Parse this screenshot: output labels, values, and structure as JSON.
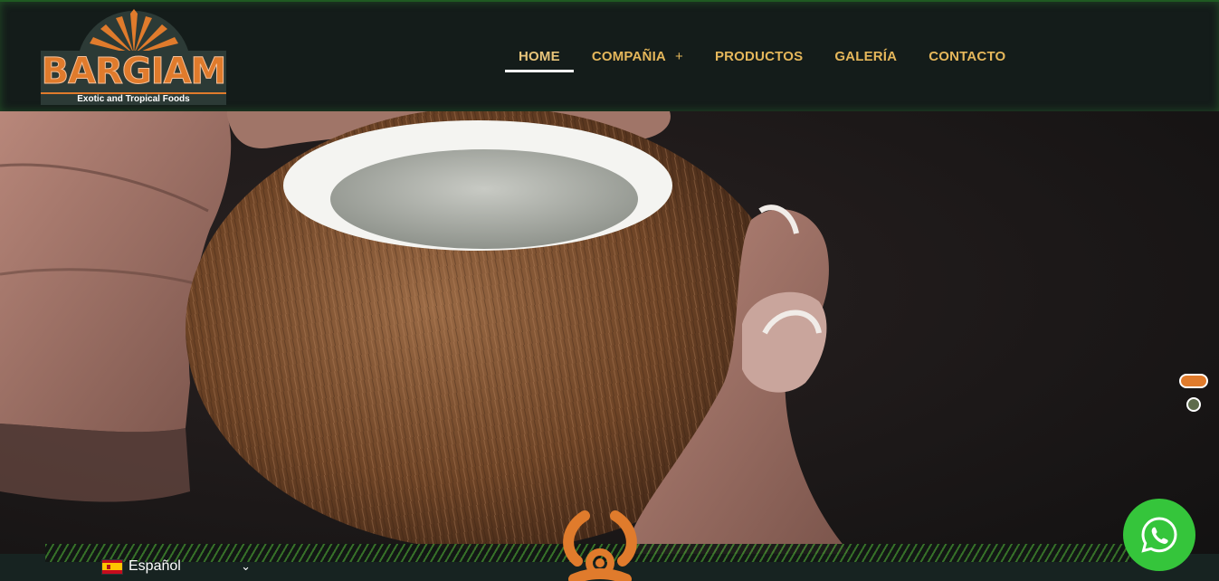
{
  "brand": {
    "name": "BARGIAM",
    "tagline": "Exotic and Tropical Foods"
  },
  "nav": {
    "items": [
      {
        "label": "HOME",
        "active": true
      },
      {
        "label": "COMPAÑIA",
        "submenu": "+"
      },
      {
        "label": "PRODUCTOS"
      },
      {
        "label": "GALERÍA"
      },
      {
        "label": "CONTACTO"
      }
    ]
  },
  "hero": {
    "image": "coconut-held-in-hands",
    "slides_total": 2,
    "slide_active": 1
  },
  "language": {
    "selected": "Español",
    "flag_icon": "spain-flag-icon",
    "chevron_icon": "chevron-down-icon"
  },
  "icons": {
    "bottom_center": "biohazard-icon",
    "chat": "whatsapp-icon"
  },
  "colors": {
    "accent_orange": "#e07b2c",
    "nav_text": "#e5b75b",
    "header_bg": "#141c1a",
    "whatsapp_green": "#35c53b"
  }
}
